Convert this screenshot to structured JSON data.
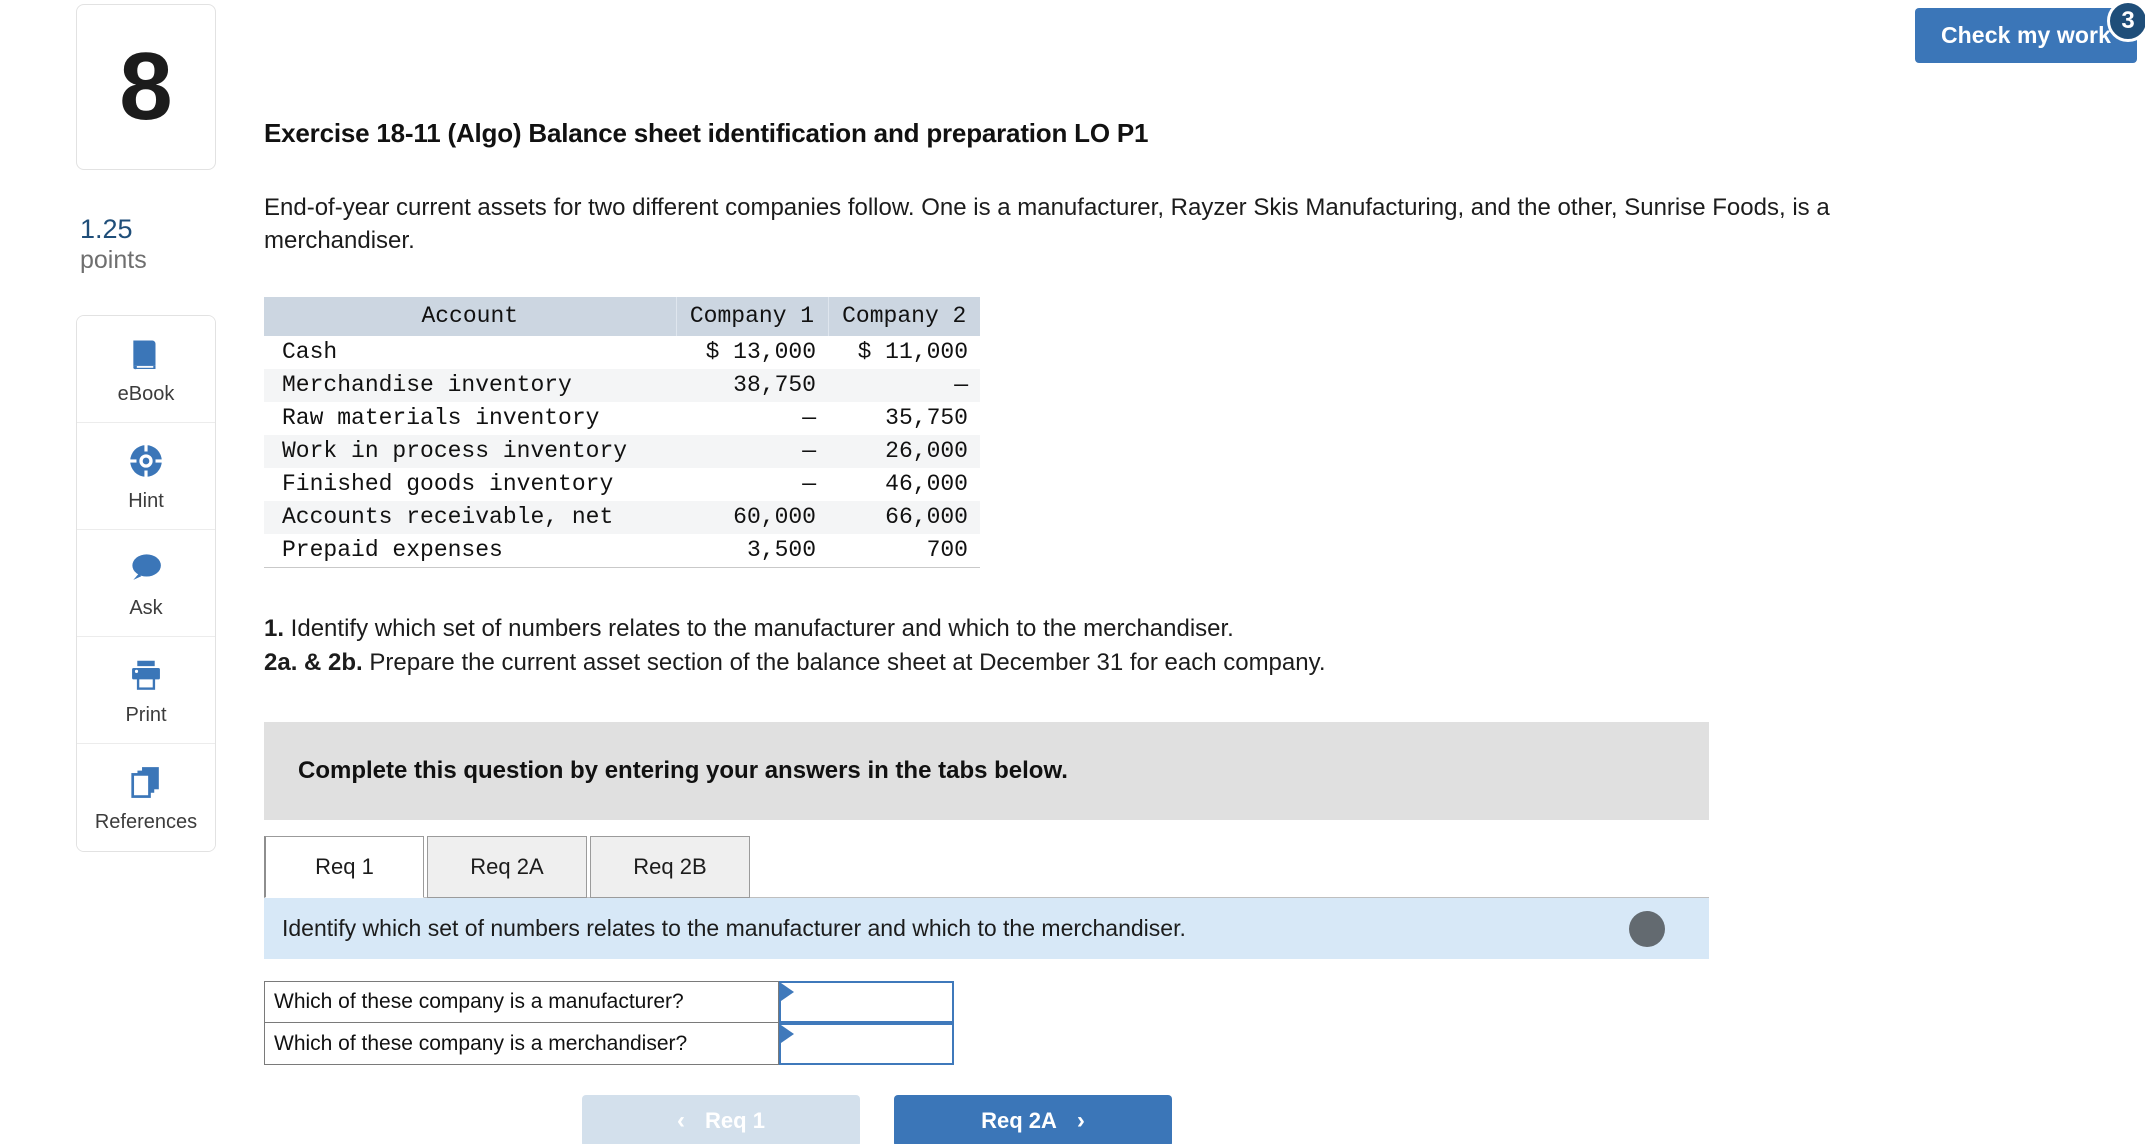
{
  "header": {
    "check_work_label": "Check my work",
    "check_work_badge": "3",
    "accent_blue": "#3b76b8",
    "badge_blue": "#1f4e79"
  },
  "rail": {
    "question_number": "8",
    "points_value": "1.25",
    "points_label": "points",
    "tools": [
      {
        "label": "eBook",
        "icon": "book-icon"
      },
      {
        "label": "Hint",
        "icon": "lifebuoy-icon"
      },
      {
        "label": "Ask",
        "icon": "chat-bubble-icon"
      },
      {
        "label": "Print",
        "icon": "printer-icon"
      },
      {
        "label": "References",
        "icon": "copies-icon"
      }
    ]
  },
  "main": {
    "exercise_title": "Exercise 18-11 (Algo) Balance sheet identification and preparation LO P1",
    "intro": "End-of-year current assets for two different companies follow. One is a manufacturer, Rayzer Skis Manufacturing, and the other, Sunrise Foods, is a merchandiser.",
    "table": {
      "headers": [
        "Account",
        "Company 1",
        "Company 2"
      ],
      "rows": [
        {
          "account": "Cash",
          "company1": "$ 13,000",
          "company2": "$ 11,000"
        },
        {
          "account": "Merchandise inventory",
          "company1": "38,750",
          "company2": "—"
        },
        {
          "account": "Raw materials inventory",
          "company1": "—",
          "company2": "35,750"
        },
        {
          "account": "Work in process inventory",
          "company1": "—",
          "company2": "26,000"
        },
        {
          "account": "Finished goods inventory",
          "company1": "—",
          "company2": "46,000"
        },
        {
          "account": "Accounts receivable, net",
          "company1": "60,000",
          "company2": "66,000"
        },
        {
          "account": "Prepaid expenses",
          "company1": "3,500",
          "company2": "700"
        }
      ]
    },
    "requirements": [
      {
        "number": "1.",
        "text": " Identify which set of numbers relates to the manufacturer and which to the merchandiser."
      },
      {
        "number": "2a. & 2b.",
        "text": " Prepare the current asset section of the balance sheet at December 31 for each company."
      }
    ],
    "complete_banner": "Complete this question by entering your answers in the tabs below.",
    "tabs": [
      {
        "label": "Req 1",
        "active": true
      },
      {
        "label": "Req 2A",
        "active": false
      },
      {
        "label": "Req 2B",
        "active": false
      }
    ],
    "blue_bar_text": "Identify which set of numbers relates to the manufacturer and which to the merchandiser.",
    "answer_rows": [
      {
        "prompt": "Which of these company is a manufacturer?",
        "value": ""
      },
      {
        "prompt": "Which of these company is a merchandiser?",
        "value": ""
      }
    ],
    "nav": {
      "prev_label": "Req 1",
      "prev_chevron": "‹",
      "next_label": "Req 2A",
      "next_chevron": "›"
    }
  }
}
